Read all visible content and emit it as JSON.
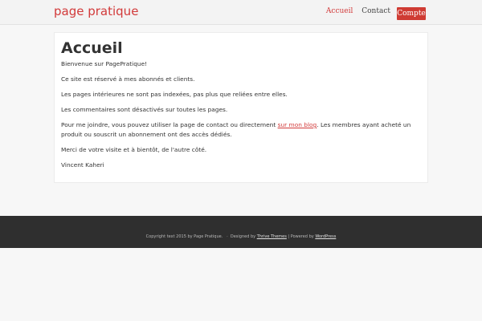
{
  "header": {
    "logo_text": "page pratique",
    "nav": {
      "items": [
        {
          "label": "Accueil",
          "active": true
        },
        {
          "label": "Contact",
          "active": false
        }
      ],
      "button_label": "Compte"
    }
  },
  "main": {
    "title": "Accueil",
    "paragraphs": [
      "Bienvenue sur PagePratique!",
      "Ce site est réservé à mes abonnés et clients.",
      "Les pages intérieures ne sont pas indexées, pas plus que reliées entre elles.",
      "Les commentaires sont désactivés sur toutes les pages."
    ],
    "contact_paragraph": {
      "before_link": "Pour me joindre, vous pouvez utiliser la page de contact ou directement ",
      "link": "sur mon blog",
      "after_link": ". Les membres ayant acheté un produit ou souscrit un abonnement ont des accès dédiés."
    },
    "closing": "Merci de votre visite et à bientôt, de l'autre côté.",
    "signature": "Vincent Kaheri"
  },
  "footer": {
    "copyright": "Copyright text 2015 by Page Pratique.",
    "separator": "·",
    "designed_by": "Designed by",
    "theme_link": "Thrive Themes",
    "powered_by": "| Powered by",
    "wordpress_link": "WordPress"
  },
  "colors": {
    "accent": "#d23a3a",
    "button": "#cf3b33",
    "footer_bg": "#2f2f2f",
    "page_bg": "#f7f7f7"
  }
}
